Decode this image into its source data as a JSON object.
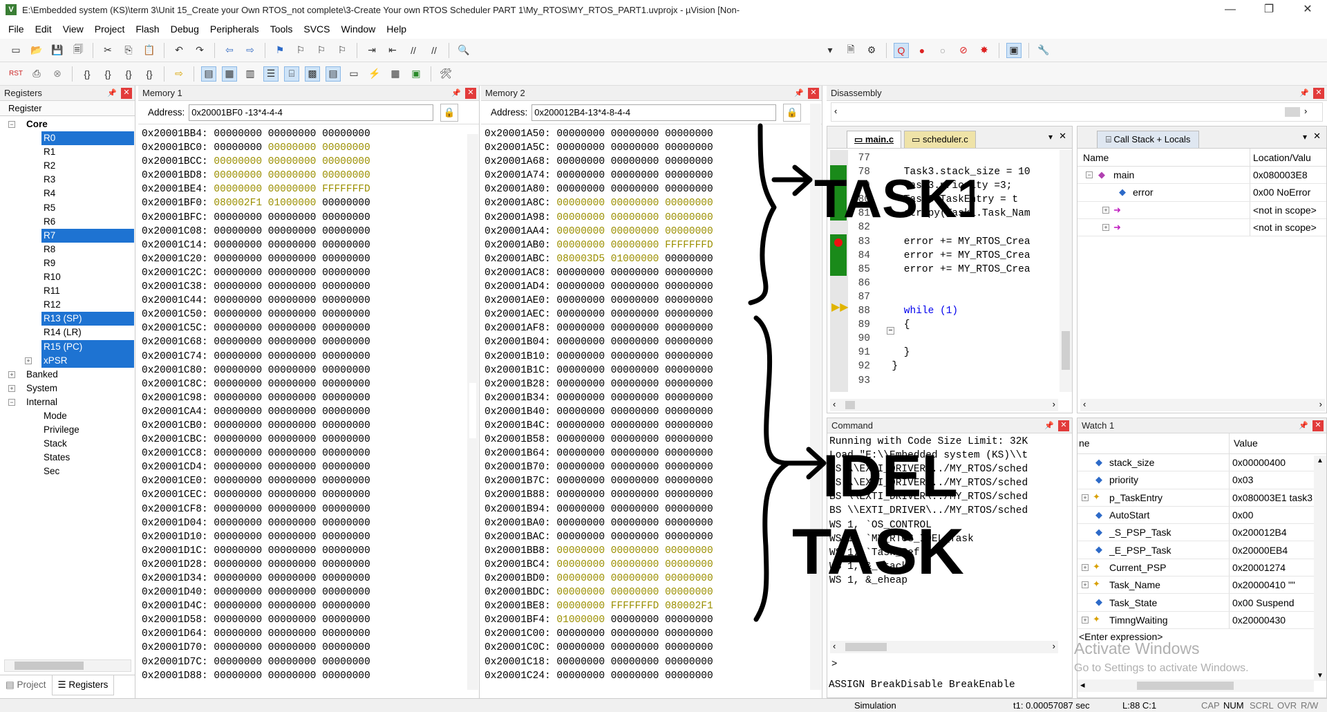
{
  "window": {
    "title": "E:\\Embedded system (KS)\\term 3\\Unit 15_Create your Own RTOS_not complete\\3-Create Your own RTOS Scheduler PART 1\\My_RTOS\\MY_RTOS_PART1.uvprojx - µVision  [Non-",
    "min": "—",
    "max": "❐",
    "close": "✕"
  },
  "menu": [
    "File",
    "Edit",
    "View",
    "Project",
    "Flash",
    "Debug",
    "Peripherals",
    "Tools",
    "SVCS",
    "Window",
    "Help"
  ],
  "registers": {
    "title": "Registers",
    "column": "Register",
    "core_label": "Core",
    "core": [
      "R0",
      "R1",
      "R2",
      "R3",
      "R4",
      "R5",
      "R6",
      "R7",
      "R8",
      "R9",
      "R10",
      "R11",
      "R12",
      "R13 (SP)",
      "R14 (LR)",
      "R15 (PC)",
      "xPSR"
    ],
    "groups": [
      "Banked",
      "System",
      "Internal"
    ],
    "internal": [
      "Mode",
      "Privilege",
      "Stack",
      "States",
      "Sec"
    ],
    "tabs": [
      "Project",
      "Registers"
    ]
  },
  "memory1": {
    "title": "Memory 1",
    "address_label": "Address:",
    "address": "0x20001BF0 -13*4-4-4",
    "rows": [
      [
        "0x20001BB4:",
        "00000000",
        "00000000",
        "00000000",
        "nnn"
      ],
      [
        "0x20001BC0:",
        "00000000",
        "00000000",
        "00000000",
        "ncc"
      ],
      [
        "0x20001BCC:",
        "00000000",
        "00000000",
        "00000000",
        "ccc"
      ],
      [
        "0x20001BD8:",
        "00000000",
        "00000000",
        "00000000",
        "ccc"
      ],
      [
        "0x20001BE4:",
        "00000000",
        "00000000",
        "FFFFFFFD",
        "ccc"
      ],
      [
        "0x20001BF0:",
        "080002F1",
        "01000000",
        "00000000",
        "ccn"
      ],
      [
        "0x20001BFC:",
        "00000000",
        "00000000",
        "00000000",
        "nnn"
      ],
      [
        "0x20001C08:",
        "00000000",
        "00000000",
        "00000000",
        "nnn"
      ],
      [
        "0x20001C14:",
        "00000000",
        "00000000",
        "00000000",
        "nnn"
      ],
      [
        "0x20001C20:",
        "00000000",
        "00000000",
        "00000000",
        "nnn"
      ],
      [
        "0x20001C2C:",
        "00000000",
        "00000000",
        "00000000",
        "nnn"
      ],
      [
        "0x20001C38:",
        "00000000",
        "00000000",
        "00000000",
        "nnn"
      ],
      [
        "0x20001C44:",
        "00000000",
        "00000000",
        "00000000",
        "nnn"
      ],
      [
        "0x20001C50:",
        "00000000",
        "00000000",
        "00000000",
        "nnn"
      ],
      [
        "0x20001C5C:",
        "00000000",
        "00000000",
        "00000000",
        "nnn"
      ],
      [
        "0x20001C68:",
        "00000000",
        "00000000",
        "00000000",
        "nnn"
      ],
      [
        "0x20001C74:",
        "00000000",
        "00000000",
        "00000000",
        "nnn"
      ],
      [
        "0x20001C80:",
        "00000000",
        "00000000",
        "00000000",
        "nnn"
      ],
      [
        "0x20001C8C:",
        "00000000",
        "00000000",
        "00000000",
        "nnn"
      ],
      [
        "0x20001C98:",
        "00000000",
        "00000000",
        "00000000",
        "nnn"
      ],
      [
        "0x20001CA4:",
        "00000000",
        "00000000",
        "00000000",
        "nnn"
      ],
      [
        "0x20001CB0:",
        "00000000",
        "00000000",
        "00000000",
        "nnn"
      ],
      [
        "0x20001CBC:",
        "00000000",
        "00000000",
        "00000000",
        "nnn"
      ],
      [
        "0x20001CC8:",
        "00000000",
        "00000000",
        "00000000",
        "nnn"
      ],
      [
        "0x20001CD4:",
        "00000000",
        "00000000",
        "00000000",
        "nnn"
      ],
      [
        "0x20001CE0:",
        "00000000",
        "00000000",
        "00000000",
        "nnn"
      ],
      [
        "0x20001CEC:",
        "00000000",
        "00000000",
        "00000000",
        "nnn"
      ],
      [
        "0x20001CF8:",
        "00000000",
        "00000000",
        "00000000",
        "nnn"
      ],
      [
        "0x20001D04:",
        "00000000",
        "00000000",
        "00000000",
        "nnn"
      ],
      [
        "0x20001D10:",
        "00000000",
        "00000000",
        "00000000",
        "nnn"
      ],
      [
        "0x20001D1C:",
        "00000000",
        "00000000",
        "00000000",
        "nnn"
      ],
      [
        "0x20001D28:",
        "00000000",
        "00000000",
        "00000000",
        "nnn"
      ],
      [
        "0x20001D34:",
        "00000000",
        "00000000",
        "00000000",
        "nnn"
      ],
      [
        "0x20001D40:",
        "00000000",
        "00000000",
        "00000000",
        "nnn"
      ],
      [
        "0x20001D4C:",
        "00000000",
        "00000000",
        "00000000",
        "nnn"
      ],
      [
        "0x20001D58:",
        "00000000",
        "00000000",
        "00000000",
        "nnn"
      ],
      [
        "0x20001D64:",
        "00000000",
        "00000000",
        "00000000",
        "nnn"
      ],
      [
        "0x20001D70:",
        "00000000",
        "00000000",
        "00000000",
        "nnn"
      ],
      [
        "0x20001D7C:",
        "00000000",
        "00000000",
        "00000000",
        "nnn"
      ],
      [
        "0x20001D88:",
        "00000000",
        "00000000",
        "00000000",
        "nnn"
      ]
    ]
  },
  "memory2": {
    "title": "Memory 2",
    "address_label": "Address:",
    "address": "0x200012B4-13*4-8-4-4",
    "rows": [
      [
        "0x20001A50:",
        "00000000",
        "00000000",
        "00000000",
        "nnn"
      ],
      [
        "0x20001A5C:",
        "00000000",
        "00000000",
        "00000000",
        "nnn"
      ],
      [
        "0x20001A68:",
        "00000000",
        "00000000",
        "00000000",
        "nnn"
      ],
      [
        "0x20001A74:",
        "00000000",
        "00000000",
        "00000000",
        "nnn"
      ],
      [
        "0x20001A80:",
        "00000000",
        "00000000",
        "00000000",
        "nnn"
      ],
      [
        "0x20001A8C:",
        "00000000",
        "00000000",
        "00000000",
        "ccc"
      ],
      [
        "0x20001A98:",
        "00000000",
        "00000000",
        "00000000",
        "ccc"
      ],
      [
        "0x20001AA4:",
        "00000000",
        "00000000",
        "00000000",
        "ccc"
      ],
      [
        "0x20001AB0:",
        "00000000",
        "00000000",
        "FFFFFFFD",
        "ccc"
      ],
      [
        "0x20001ABC:",
        "080003D5",
        "01000000",
        "00000000",
        "ccn"
      ],
      [
        "0x20001AC8:",
        "00000000",
        "00000000",
        "00000000",
        "nnn"
      ],
      [
        "0x20001AD4:",
        "00000000",
        "00000000",
        "00000000",
        "nnn"
      ],
      [
        "0x20001AE0:",
        "00000000",
        "00000000",
        "00000000",
        "nnn"
      ],
      [
        "0x20001AEC:",
        "00000000",
        "00000000",
        "00000000",
        "nnn"
      ],
      [
        "0x20001AF8:",
        "00000000",
        "00000000",
        "00000000",
        "nnn"
      ],
      [
        "0x20001B04:",
        "00000000",
        "00000000",
        "00000000",
        "nnn"
      ],
      [
        "0x20001B10:",
        "00000000",
        "00000000",
        "00000000",
        "nnn"
      ],
      [
        "0x20001B1C:",
        "00000000",
        "00000000",
        "00000000",
        "nnn"
      ],
      [
        "0x20001B28:",
        "00000000",
        "00000000",
        "00000000",
        "nnn"
      ],
      [
        "0x20001B34:",
        "00000000",
        "00000000",
        "00000000",
        "nnn"
      ],
      [
        "0x20001B40:",
        "00000000",
        "00000000",
        "00000000",
        "nnn"
      ],
      [
        "0x20001B4C:",
        "00000000",
        "00000000",
        "00000000",
        "nnn"
      ],
      [
        "0x20001B58:",
        "00000000",
        "00000000",
        "00000000",
        "nnn"
      ],
      [
        "0x20001B64:",
        "00000000",
        "00000000",
        "00000000",
        "nnn"
      ],
      [
        "0x20001B70:",
        "00000000",
        "00000000",
        "00000000",
        "nnn"
      ],
      [
        "0x20001B7C:",
        "00000000",
        "00000000",
        "00000000",
        "nnn"
      ],
      [
        "0x20001B88:",
        "00000000",
        "00000000",
        "00000000",
        "nnn"
      ],
      [
        "0x20001B94:",
        "00000000",
        "00000000",
        "00000000",
        "nnn"
      ],
      [
        "0x20001BA0:",
        "00000000",
        "00000000",
        "00000000",
        "nnn"
      ],
      [
        "0x20001BAC:",
        "00000000",
        "00000000",
        "00000000",
        "nnn"
      ],
      [
        "0x20001BB8:",
        "00000000",
        "00000000",
        "00000000",
        "ccc"
      ],
      [
        "0x20001BC4:",
        "00000000",
        "00000000",
        "00000000",
        "ccc"
      ],
      [
        "0x20001BD0:",
        "00000000",
        "00000000",
        "00000000",
        "ccc"
      ],
      [
        "0x20001BDC:",
        "00000000",
        "00000000",
        "00000000",
        "ccc"
      ],
      [
        "0x20001BE8:",
        "00000000",
        "FFFFFFFD",
        "080002F1",
        "ccc"
      ],
      [
        "0x20001BF4:",
        "01000000",
        "00000000",
        "00000000",
        "cnn"
      ],
      [
        "0x20001C00:",
        "00000000",
        "00000000",
        "00000000",
        "nnn"
      ],
      [
        "0x20001C0C:",
        "00000000",
        "00000000",
        "00000000",
        "nnn"
      ],
      [
        "0x20001C18:",
        "00000000",
        "00000000",
        "00000000",
        "nnn"
      ],
      [
        "0x20001C24:",
        "00000000",
        "00000000",
        "00000000",
        "nnn"
      ]
    ]
  },
  "disassembly": {
    "title": "Disassembly"
  },
  "editor": {
    "tabs": [
      "main.c",
      "scheduler.c"
    ],
    "lines": [
      {
        "n": "77",
        "t": ""
      },
      {
        "n": "78",
        "t": "    Task3.stack_size = 10"
      },
      {
        "n": "79",
        "t": "    Task3.priority =3;"
      },
      {
        "n": "80",
        "t": "    Task3.TaskEntry = t"
      },
      {
        "n": "81",
        "t": "    strcpy(Task1.Task_Nam"
      },
      {
        "n": "82",
        "t": ""
      },
      {
        "n": "83",
        "t": "    error += MY_RTOS_Crea"
      },
      {
        "n": "84",
        "t": "    error += MY_RTOS_Crea"
      },
      {
        "n": "85",
        "t": "    error += MY_RTOS_Crea"
      },
      {
        "n": "86",
        "t": ""
      },
      {
        "n": "87",
        "t": ""
      },
      {
        "n": "88",
        "t": "    while (1)"
      },
      {
        "n": "89",
        "t": "    {"
      },
      {
        "n": "90",
        "t": ""
      },
      {
        "n": "91",
        "t": "    }"
      },
      {
        "n": "92",
        "t": "  }"
      },
      {
        "n": "93",
        "t": ""
      }
    ]
  },
  "callstack": {
    "title": "Call Stack + Locals",
    "columns": [
      "Name",
      "Location/Valu"
    ],
    "rows": [
      {
        "name": "main",
        "value": "0x080003E8"
      },
      {
        "name": "error",
        "value": "0x00 NoError"
      },
      {
        "name": "",
        "value": "<not in scope>"
      },
      {
        "name": "",
        "value": "<not in scope>"
      }
    ]
  },
  "command": {
    "title": "Command",
    "lines": [
      "Running with Code Size Limit: 32K",
      "Load \"E:\\\\Embedded system (KS)\\\\t",
      "BS \\\\EXTI_DRIVER\\../MY_RTOS/sched",
      "BS \\\\EXTI_DRIVER\\../MY_RTOS/sched",
      "BS \\\\EXTI_DRIVER\\../MY_RTOS/sched",
      "BS \\\\EXTI_DRIVER\\../MY_RTOS/sched",
      "WS 1, `OS_CONTROL",
      "WS 1, `MY_RTOS_IDEL_Task",
      "WS 1, `Task_Ref",
      "WS 1, &_stack",
      "WS 1, &_eheap"
    ],
    "prompt": ">",
    "hint": "ASSIGN BreakDisable BreakEnable"
  },
  "watch": {
    "title": "Watch 1",
    "columns": [
      "ne",
      "Value"
    ],
    "rows": [
      {
        "name": "stack_size",
        "value": "0x00000400",
        "exp": false
      },
      {
        "name": "priority",
        "value": "0x03",
        "exp": false
      },
      {
        "name": "p_TaskEntry",
        "value": "0x080003E1 task3",
        "exp": true
      },
      {
        "name": "AutoStart",
        "value": "0x00",
        "exp": false
      },
      {
        "name": "_S_PSP_Task",
        "value": "0x200012B4",
        "exp": false
      },
      {
        "name": "_E_PSP_Task",
        "value": "0x20000EB4",
        "exp": false
      },
      {
        "name": "Current_PSP",
        "value": "0x20001274",
        "exp": true
      },
      {
        "name": "Task_Name",
        "value": "0x20000410 \"\"",
        "exp": true
      },
      {
        "name": "Task_State",
        "value": "0x00 Suspend",
        "exp": false
      },
      {
        "name": "TimngWaiting",
        "value": "0x20000430",
        "exp": true
      }
    ],
    "enter": "<Enter expression>"
  },
  "annotations": {
    "a1": "TASK1",
    "a2": "IDEL",
    "a3": "TASK"
  },
  "activate": {
    "l1": "Activate Windows",
    "l2": "Go to Settings to activate Windows."
  },
  "status": {
    "mode": "Simulation",
    "time": "t1: 0.00057087 sec",
    "pos": "L:88 C:1",
    "caps": "CAP",
    "num": "NUM",
    "scrl": "SCRL",
    "ovr": "OVR",
    "rw": "R/W"
  }
}
